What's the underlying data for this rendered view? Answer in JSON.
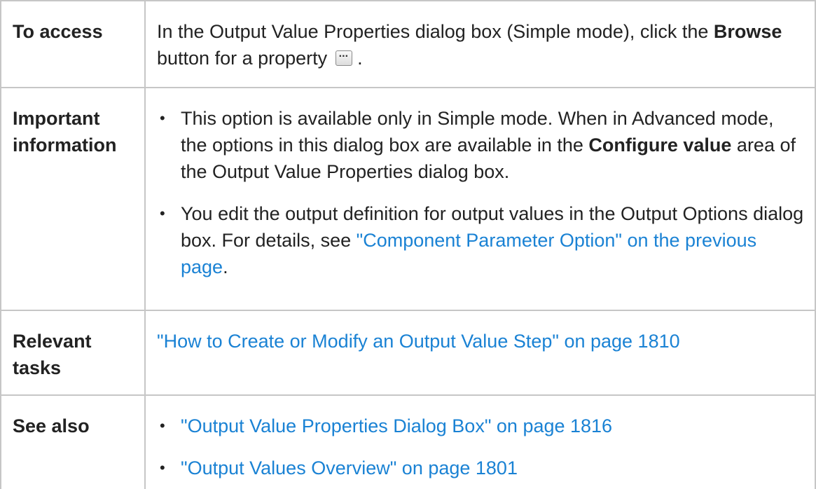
{
  "rows": {
    "access": {
      "label": "To access",
      "text_before": "In the Output Value Properties dialog box (Simple mode), click the ",
      "bold": "Browse",
      "text_after": " button for a property",
      "end_text": " ."
    },
    "important": {
      "label_line1": "Important",
      "label_line2": "information",
      "bullet1": {
        "text_before": "This option is available only in Simple mode. When in Advanced mode, the options in this dialog box are available in the ",
        "bold": "Configure value",
        "text_after": " area of the Output Value Properties dialog box."
      },
      "bullet2": {
        "text_before": "You edit the output definition for output values in the Output Options dialog box. For details, see ",
        "link": "\"Component Parameter Option\" on the previous page",
        "text_after": "."
      }
    },
    "tasks": {
      "label_line1": "Relevant",
      "label_line2": "tasks",
      "link": "\"How to Create or Modify an Output Value Step\" on page 1810"
    },
    "see_also": {
      "label": "See also",
      "links": [
        "\"Output Value Properties Dialog Box\" on page 1816",
        "\"Output Values Overview\" on page 1801"
      ]
    }
  },
  "bullet_glyph": "•",
  "link_color": "#1a82d4",
  "border_color": "#c6c6c6"
}
